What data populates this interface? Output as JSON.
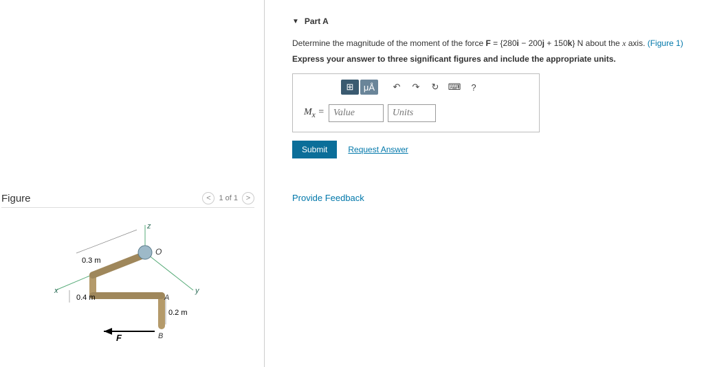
{
  "left": {
    "figure_title": "Figure",
    "pager": {
      "prev": "<",
      "current": "1 of 1",
      "next": ">"
    },
    "labels": {
      "z": "z",
      "y": "y",
      "x": "x",
      "O": "O",
      "A": "A",
      "B": "B",
      "F": "F",
      "d1": "0.3 m",
      "d2": "0.4 m",
      "d3": "0.2 m"
    }
  },
  "part": {
    "header": "Part A",
    "q_pre": "Determine the magnitude of the moment of the force ",
    "q_F": "F",
    "q_eq": " = {280",
    "q_i": "i",
    "q_mid": " − 200",
    "q_j": "j",
    "q_mid2": " + 150",
    "q_k": "k",
    "q_post": "} N about the ",
    "q_axis": "x",
    "q_end": " axis. ",
    "fig_link": "(Figure 1)",
    "instruction": "Express your answer to three significant figures and include the appropriate units.",
    "toolbar": {
      "templates": "⊞",
      "symbols": "μÅ",
      "undo": "↶",
      "redo": "↷",
      "reset": "↻",
      "keyboard": "⌨",
      "help": "?"
    },
    "answer_label_var": "M",
    "answer_label_sub": "x",
    "answer_label_eq": " = ",
    "value_ph": "Value",
    "units_ph": "Units",
    "submit": "Submit",
    "request": "Request Answer"
  },
  "feedback": "Provide Feedback"
}
